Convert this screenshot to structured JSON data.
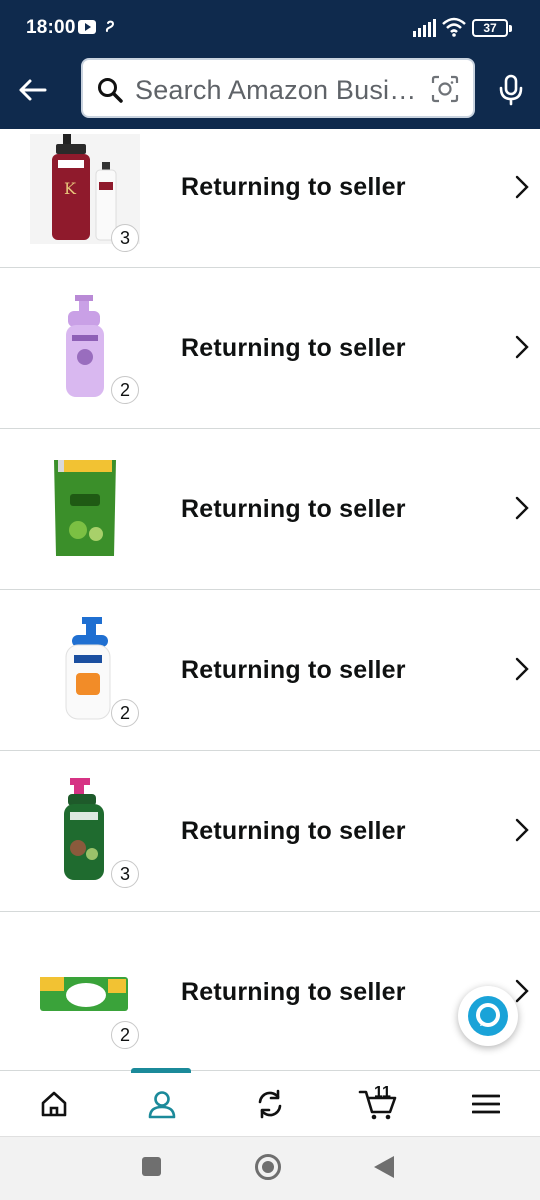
{
  "status_bar": {
    "time": "18:00",
    "battery": "37",
    "icons": [
      "youtube-icon",
      "swirl-icon",
      "signal-icon",
      "wifi-icon",
      "battery-icon"
    ]
  },
  "header": {
    "search_placeholder": "Search Amazon Busi…",
    "icons": [
      "back-arrow-icon",
      "search-icon",
      "camera-icon",
      "mic-icon"
    ]
  },
  "items": [
    {
      "status": "Returning to seller",
      "quantity": "3",
      "product_icon": "tresemme-shampoo-bottles"
    },
    {
      "status": "Returning to seller",
      "quantity": "2",
      "product_icon": "purple-shampoo-bottle"
    },
    {
      "status": "Returning to seller",
      "quantity": "",
      "product_icon": "vatika-refill-pouch"
    },
    {
      "status": "Returning to seller",
      "quantity": "2",
      "product_icon": "white-shampoo-bottle"
    },
    {
      "status": "Returning to seller",
      "quantity": "3",
      "product_icon": "green-hair-oil-bottle"
    },
    {
      "status": "Returning to seller",
      "quantity": "2",
      "product_icon": "soap-pack"
    }
  ],
  "bottom_nav": {
    "cart_count": "11",
    "items": [
      "home-icon",
      "account-icon",
      "returns-icon",
      "cart-icon",
      "menu-icon"
    ],
    "active": "account-icon",
    "accent_color": "#1b8a9a"
  },
  "colors": {
    "header_bg": "#0f2a4d",
    "alexa": "#1aa3d8"
  }
}
